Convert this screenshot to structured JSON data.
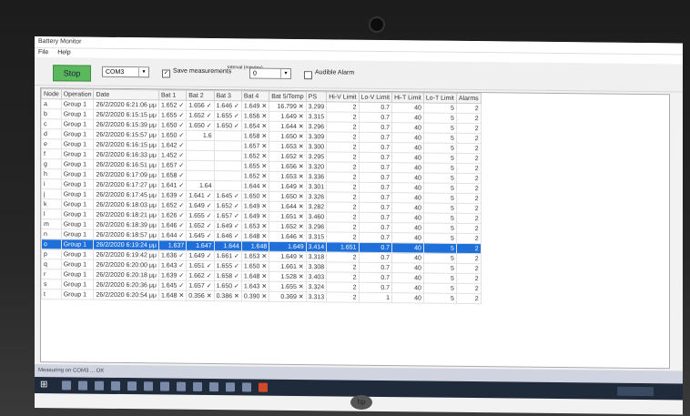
{
  "window": {
    "title": "Battery Monitor"
  },
  "menu": [
    "File",
    "Help"
  ],
  "toolbar": {
    "stop_label": "Stop",
    "port_value": "COM3",
    "save_label": "Save measurements",
    "interval_label": "Interval (minutes)",
    "interval_value": "0",
    "alarm_label": "Audible Alarm"
  },
  "grid": {
    "headers": [
      "Node",
      "Operation",
      "Date",
      "Bat 1",
      "Bat 2",
      "Bat 3",
      "Bat 4",
      "Bat 5/Temp",
      "PS",
      "Hi-V Limit",
      "Lo-V Limit",
      "Hi-T Limit",
      "Lo-T Limit",
      "Alarms"
    ],
    "rows": [
      [
        "a",
        "Group 1",
        "26/2/2020 6:21:06 μμ",
        "1.652 ✓",
        "1.656 ✓",
        "1.646 ✓",
        "1.649 ✕",
        "16.799 ✕",
        "3.299",
        "2",
        "0.7",
        "40",
        "5",
        "2"
      ],
      [
        "b",
        "Group 1",
        "26/2/2020 6:15:15 μμ",
        "1.655 ✓",
        "1.652 ✓",
        "1.655 ✓",
        "1.656 ✕",
        "1.649 ✕",
        "3.315",
        "2",
        "0.7",
        "40",
        "5",
        "2"
      ],
      [
        "c",
        "Group 1",
        "26/2/2020 6:15:39 μμ",
        "1.650 ✓",
        "1.650 ✓",
        "1.650 ✓",
        "1.654 ✕",
        "1.644 ✕",
        "3.296",
        "2",
        "0.7",
        "40",
        "5",
        "2"
      ],
      [
        "d",
        "Group 1",
        "26/2/2020 6:15:57 μμ",
        "1.650 ✓",
        "1.6",
        "",
        "1.658 ✕",
        "1.650 ✕",
        "3.309",
        "2",
        "0.7",
        "40",
        "5",
        "2"
      ],
      [
        "e",
        "Group 1",
        "26/2/2020 6:16:15 μμ",
        "1.642 ✓",
        "",
        "",
        "1.657 ✕",
        "1.653 ✕",
        "3.300",
        "2",
        "0.7",
        "40",
        "5",
        "2"
      ],
      [
        "f",
        "Group 1",
        "26/2/2020 6:16:33 μμ",
        "1.452 ✓",
        "",
        "",
        "1.652 ✕",
        "1.652 ✕",
        "3.295",
        "2",
        "0.7",
        "40",
        "5",
        "2"
      ],
      [
        "g",
        "Group 1",
        "26/2/2020 6:16:51 μμ",
        "1.657 ✓",
        "",
        "",
        "1.655 ✕",
        "1.656 ✕",
        "3.320",
        "2",
        "0.7",
        "40",
        "5",
        "2"
      ],
      [
        "h",
        "Group 1",
        "26/2/2020 6:17:09 μμ",
        "1.658 ✓",
        "",
        "",
        "1.652 ✕",
        "1.653 ✕",
        "3.336",
        "2",
        "0.7",
        "40",
        "5",
        "2"
      ],
      [
        "i",
        "Group 1",
        "26/2/2020 6:17:27 μμ",
        "1.641 ✓",
        "1.64",
        "",
        "1.644 ✕",
        "1.649 ✕",
        "3.301",
        "2",
        "0.7",
        "40",
        "5",
        "2"
      ],
      [
        "j",
        "Group 1",
        "26/2/2020 6:17:45 μμ",
        "1.639 ✓",
        "1.641 ✓",
        "1.645 ✓",
        "1.650 ✕",
        "1.650 ✕",
        "3.326",
        "2",
        "0.7",
        "40",
        "5",
        "2"
      ],
      [
        "k",
        "Group 1",
        "26/2/2020 6:18:03 μμ",
        "1.652 ✓",
        "1.649 ✓",
        "1.652 ✓",
        "1.649 ✕",
        "1.644 ✕",
        "3.282",
        "2",
        "0.7",
        "40",
        "5",
        "2"
      ],
      [
        "l",
        "Group 1",
        "26/2/2020 6:18:21 μμ",
        "1.626 ✓",
        "1.655 ✓",
        "1.657 ✓",
        "1.649 ✕",
        "1.651 ✕",
        "3.460",
        "2",
        "0.7",
        "40",
        "5",
        "2"
      ],
      [
        "m",
        "Group 1",
        "26/2/2020 6:18:39 μμ",
        "1.646 ✓",
        "1.652 ✓",
        "1.649 ✓",
        "1.653 ✕",
        "1.652 ✕",
        "3.296",
        "2",
        "0.7",
        "40",
        "5",
        "2"
      ],
      [
        "n",
        "Group 1",
        "26/2/2020 6:18:57 μμ",
        "1.644 ✓",
        "1.645 ✓",
        "1.646 ✓",
        "1.648 ✕",
        "1.646 ✕",
        "3.315",
        "2",
        "0.7",
        "40",
        "5",
        "2"
      ],
      [
        "o",
        "Group 1",
        "26/2/2020 6:19:24 μμ",
        "1.637",
        "1.647",
        "1.644",
        "1.648",
        "1.649",
        "3.414",
        "1.651",
        "0.7",
        "40",
        "5",
        "2"
      ],
      [
        "p",
        "Group 1",
        "26/2/2020 6:19:42 μμ",
        "1.636 ✓",
        "1.649 ✓",
        "1.661 ✓",
        "1.653 ✕",
        "1.649 ✕",
        "3.318",
        "2",
        "0.7",
        "40",
        "5",
        "2"
      ],
      [
        "q",
        "Group 1",
        "26/2/2020 6:20:00 μμ",
        "1.643 ✓",
        "1.651 ✓",
        "1.655 ✓",
        "1.650 ✕",
        "1.661 ✕",
        "3.308",
        "2",
        "0.7",
        "40",
        "5",
        "2"
      ],
      [
        "r",
        "Group 1",
        "26/2/2020 6:20:18 μμ",
        "1.639 ✓",
        "1.662 ✓",
        "1.658 ✓",
        "1.648 ✕",
        "1.528 ✕",
        "3.403",
        "2",
        "0.7",
        "40",
        "5",
        "2"
      ],
      [
        "s",
        "Group 1",
        "26/2/2020 6:20:36 μμ",
        "1.645 ✓",
        "1.657 ✓",
        "1.650 ✓",
        "1.643 ✕",
        "1.655 ✕",
        "3.324",
        "2",
        "0.7",
        "40",
        "5",
        "2"
      ],
      [
        "t",
        "Group 1",
        "26/2/2020 6:20:54 μμ",
        "1.648 ✕",
        "0.356 ✕",
        "0.386 ✕",
        "0.390 ✕",
        "0.369 ✕",
        "3.313",
        "2",
        "1",
        "40",
        "5",
        "2"
      ]
    ],
    "selected_row": 14
  },
  "statusbar": {
    "text": "Measuring on COM3 ... OK"
  },
  "colors": {
    "selection": "#1e6fd9",
    "stop_button": "#5cb85c",
    "taskbar": "#1f2a3a"
  }
}
